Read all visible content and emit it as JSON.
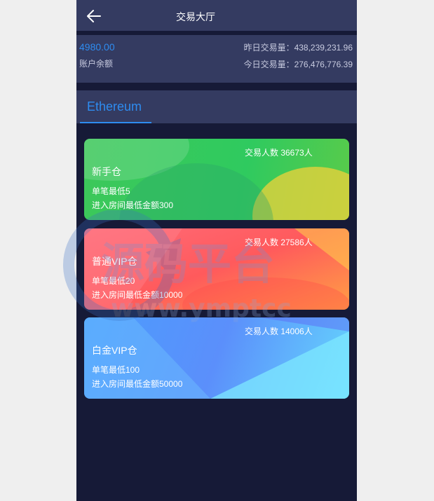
{
  "header": {
    "title": "交易大厅",
    "back_icon": "arrow-left-icon"
  },
  "account": {
    "balance": "4980.00",
    "balance_label": "账户余额",
    "yesterday_volume": "昨日交易量：438,239,231.96",
    "today_volume": "今日交易量：276,476,776.39"
  },
  "tabs": [
    {
      "label": "Ethereum",
      "active": true
    }
  ],
  "rooms": [
    {
      "count": "交易人数 36673人",
      "name": "新手仓",
      "min_bet": "单笔最低5",
      "min_entry": "进入房间最低金额300",
      "color": "#36c95b"
    },
    {
      "count": "交易人数 27586人",
      "name": "普通VIP仓",
      "min_bet": "单笔最低20",
      "min_entry": "进入房间最低金额10000",
      "color": "#ff5e63"
    },
    {
      "count": "交易人数 14006人",
      "name": "白金VIP仓",
      "min_bet": "单笔最低100",
      "min_entry": "进入房间最低金额50000",
      "color": "#5a93fb"
    }
  ],
  "watermark": {
    "title": "源码平台",
    "url": "www.ymptcc",
    "color": "#b7c9e6"
  },
  "colors": {
    "accent": "#2e8cf0",
    "panel": "#343b61",
    "background": "#161a37"
  }
}
